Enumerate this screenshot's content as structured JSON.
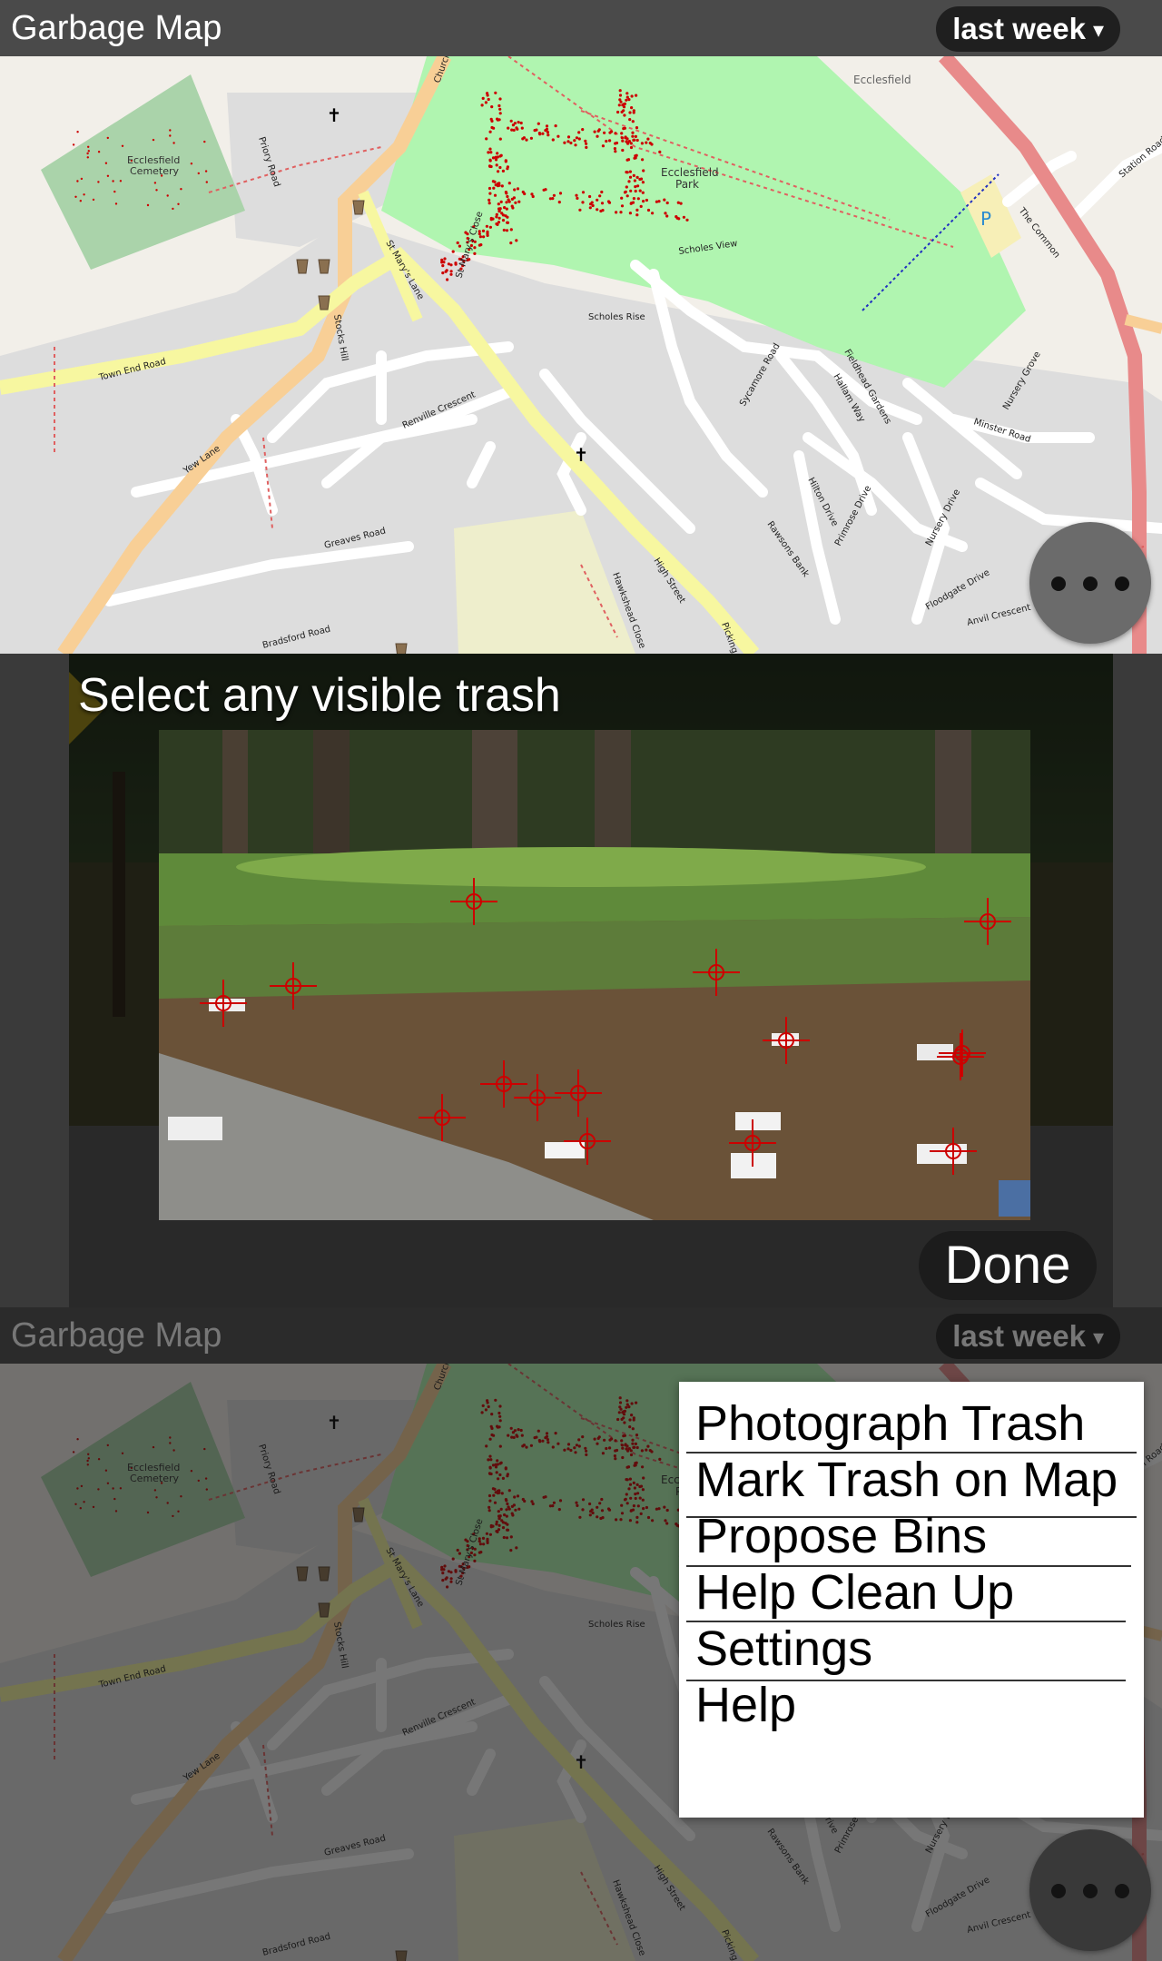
{
  "app": {
    "title": "Garbage Map",
    "time_filter": "last week",
    "caret": "▾"
  },
  "map_labels": {
    "cemetery": "Ecclesfield Cemetery",
    "park": "Ecclesfield Park",
    "ecclesfield": "Ecclesfield",
    "parking": "P",
    "roads": [
      "Town End Road",
      "Yew Lane",
      "Priory Road",
      "St Mary's Lane",
      "St Mary's Close",
      "Stocks Hill",
      "Renville Crescent",
      "Greaves Road",
      "Bradsford Road",
      "High Street",
      "Scholes View",
      "Scholes Rise",
      "Sycamore Road",
      "Hallam Way",
      "Fieldhead Gardens",
      "Hilton Drive",
      "Rawsons Bank",
      "Primrose Drive",
      "Nursery Drive",
      "Floodgate Drive",
      "Anvil Crescent",
      "Minster Road",
      "Nursery Grove",
      "The Common",
      "Station Road",
      "Church Street",
      "Picking Lane",
      "Hawkshead Close"
    ]
  },
  "camera": {
    "instruction": "Select any visible trash",
    "done_label": "Done",
    "marker_count": 15
  },
  "menu": {
    "items": [
      "Photograph Trash",
      "Mark Trash on Map",
      "Propose Bins",
      "Help Clean Up",
      "Settings",
      "Help"
    ]
  },
  "icons": {
    "overflow": "more-horizontal-icon",
    "dropdown": "chevron-down-icon",
    "marker": "crosshair-icon"
  },
  "colors": {
    "appbar": "#4a4a4a",
    "park_green": "#b0f5b0",
    "cemetery_green": "#aad3aa",
    "marker_red": "#cc0000",
    "primary_road": "#f8cf96",
    "trunk_road": "#e88a8a"
  }
}
